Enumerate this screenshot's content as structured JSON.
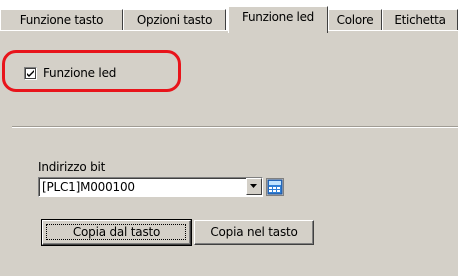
{
  "tabs": [
    {
      "label": "Funzione tasto",
      "active": false
    },
    {
      "label": "Opzioni tasto",
      "active": false
    },
    {
      "label": "Funzione led",
      "active": true
    },
    {
      "label": "Colore",
      "active": false
    },
    {
      "label": "Etichetta",
      "active": false
    }
  ],
  "led_function": {
    "checkbox_label": "Funzione led",
    "checked": true
  },
  "highlight_color": "#e8141b",
  "bit_address": {
    "label": "Indirizzo bit",
    "value": "[PLC1]M000100",
    "dropdown_icon": "chevron-down-icon",
    "input_icon": "keypad-icon"
  },
  "buttons": {
    "copy_from_key": "Copia dal tasto",
    "copy_to_key": "Copia nel tasto"
  }
}
